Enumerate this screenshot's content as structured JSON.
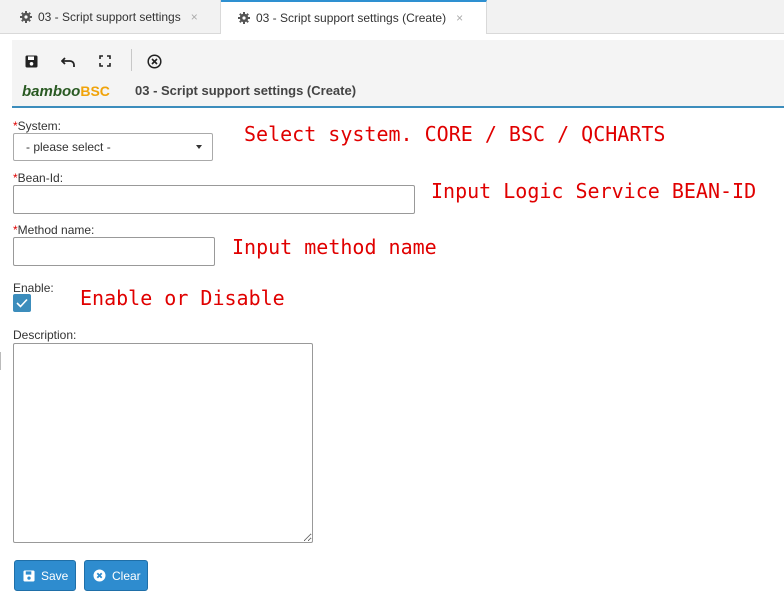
{
  "tabs": [
    {
      "label": "03 - Script support settings"
    },
    {
      "label": "03 - Script support settings (Create)"
    }
  ],
  "tab_close_glyph": "×",
  "toolbar": {
    "icons": [
      "save-icon",
      "undo-icon",
      "fullscreen-icon",
      "close-circle-icon"
    ]
  },
  "header": {
    "logo_part1": "bamboo",
    "logo_part2": "BSC",
    "title": "03 - Script support settings (Create)"
  },
  "form": {
    "required_mark": "*",
    "system_label": "System:",
    "system_selected": "- please select -",
    "bean_label": "Bean-Id:",
    "bean_value": "",
    "method_label": "Method name:",
    "method_value": "",
    "enable_label": "Enable:",
    "enable_checked": true,
    "description_label": "Description:",
    "description_value": ""
  },
  "buttons": {
    "save": "Save",
    "clear": "Clear"
  },
  "annotations": {
    "system": "Select system. CORE / BSC / QCHARTS",
    "bean": "Input Logic Service BEAN-ID",
    "method": "Input method name",
    "enable": "Enable or Disable"
  },
  "colors": {
    "accent": "#3c8dbc",
    "button": "#2e8ccf",
    "annotation": "#e00000",
    "required": "#dd0000"
  }
}
